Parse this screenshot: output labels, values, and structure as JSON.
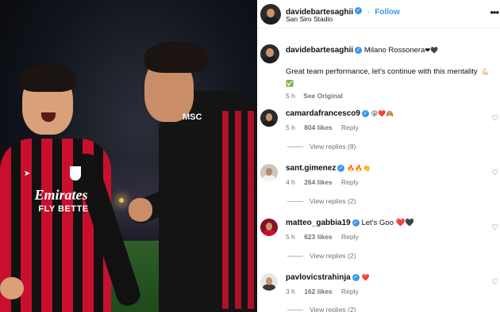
{
  "header": {
    "username": "davidebartesaghii",
    "follow_label": "Follow",
    "location": "San Siro Stadio",
    "more_icon": "more-horizontal-icon"
  },
  "caption": {
    "username": "davidebartesaghii",
    "title": "Milano Rossonera",
    "title_emoji": "❤🖤",
    "text": "Great team performance, let’s continue with this mentality",
    "text_emoji": "💪🏻 ✅",
    "time": "5 h",
    "see_original": "See Original"
  },
  "comments": [
    {
      "username": "camardafrancesco9",
      "text": "😮❤️🙈",
      "time": "5 h",
      "likes": "804 likes",
      "reply": "Reply",
      "view_replies": "View replies (8)"
    },
    {
      "username": "sant.gimenez",
      "text": "🔥🔥👏",
      "time": "4 h",
      "likes": "264 likes",
      "reply": "Reply",
      "view_replies": "View replies (2)"
    },
    {
      "username": "matteo_gabbia19",
      "text": "Let's Goo ❤️🖤",
      "time": "5 h",
      "likes": "623 likes",
      "reply": "Reply",
      "view_replies": "View replies (2)"
    },
    {
      "username": "pavlovicstrahinja",
      "text": "❤️",
      "time": "3 h",
      "likes": "162 likes",
      "reply": "Reply",
      "view_replies": "View replies (2)"
    }
  ],
  "photo": {
    "shirt_sponsor_line1": "Emirates",
    "shirt_sponsor_line2": "FLY BETTE",
    "shirt_brand": "MSC",
    "brand_logo": "puma-logo"
  },
  "colors": {
    "accent": "#3897f0",
    "milan_red": "#c8102e",
    "milan_black": "#111111"
  }
}
